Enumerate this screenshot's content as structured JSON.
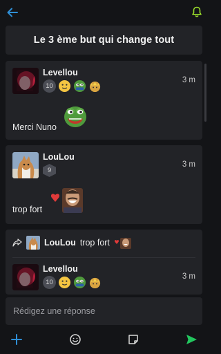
{
  "thread": {
    "title": "Le 3 ème but qui change tout"
  },
  "posts": [
    {
      "author": "Levellou",
      "time": "3 m",
      "level": "10",
      "text": "Merci Nuno"
    },
    {
      "author": "LouLou",
      "time": "3 m",
      "level": "9",
      "text": "trop fort"
    },
    {
      "quote_author": "LouLou",
      "quote_text": "trop fort",
      "author": "Levellou",
      "time": "3 m",
      "level": "10"
    }
  ],
  "reply": {
    "placeholder": "Rédigez une réponse"
  },
  "colors": {
    "accent_blue": "#2f8fd6",
    "accent_green": "#22c55e",
    "bell_green": "#9be02b",
    "card": "#222327",
    "background": "#131417"
  },
  "icons": [
    "back-arrow-icon",
    "bell-icon",
    "plus-icon",
    "emoji-icon",
    "note-icon",
    "send-icon",
    "reply-share-icon"
  ]
}
